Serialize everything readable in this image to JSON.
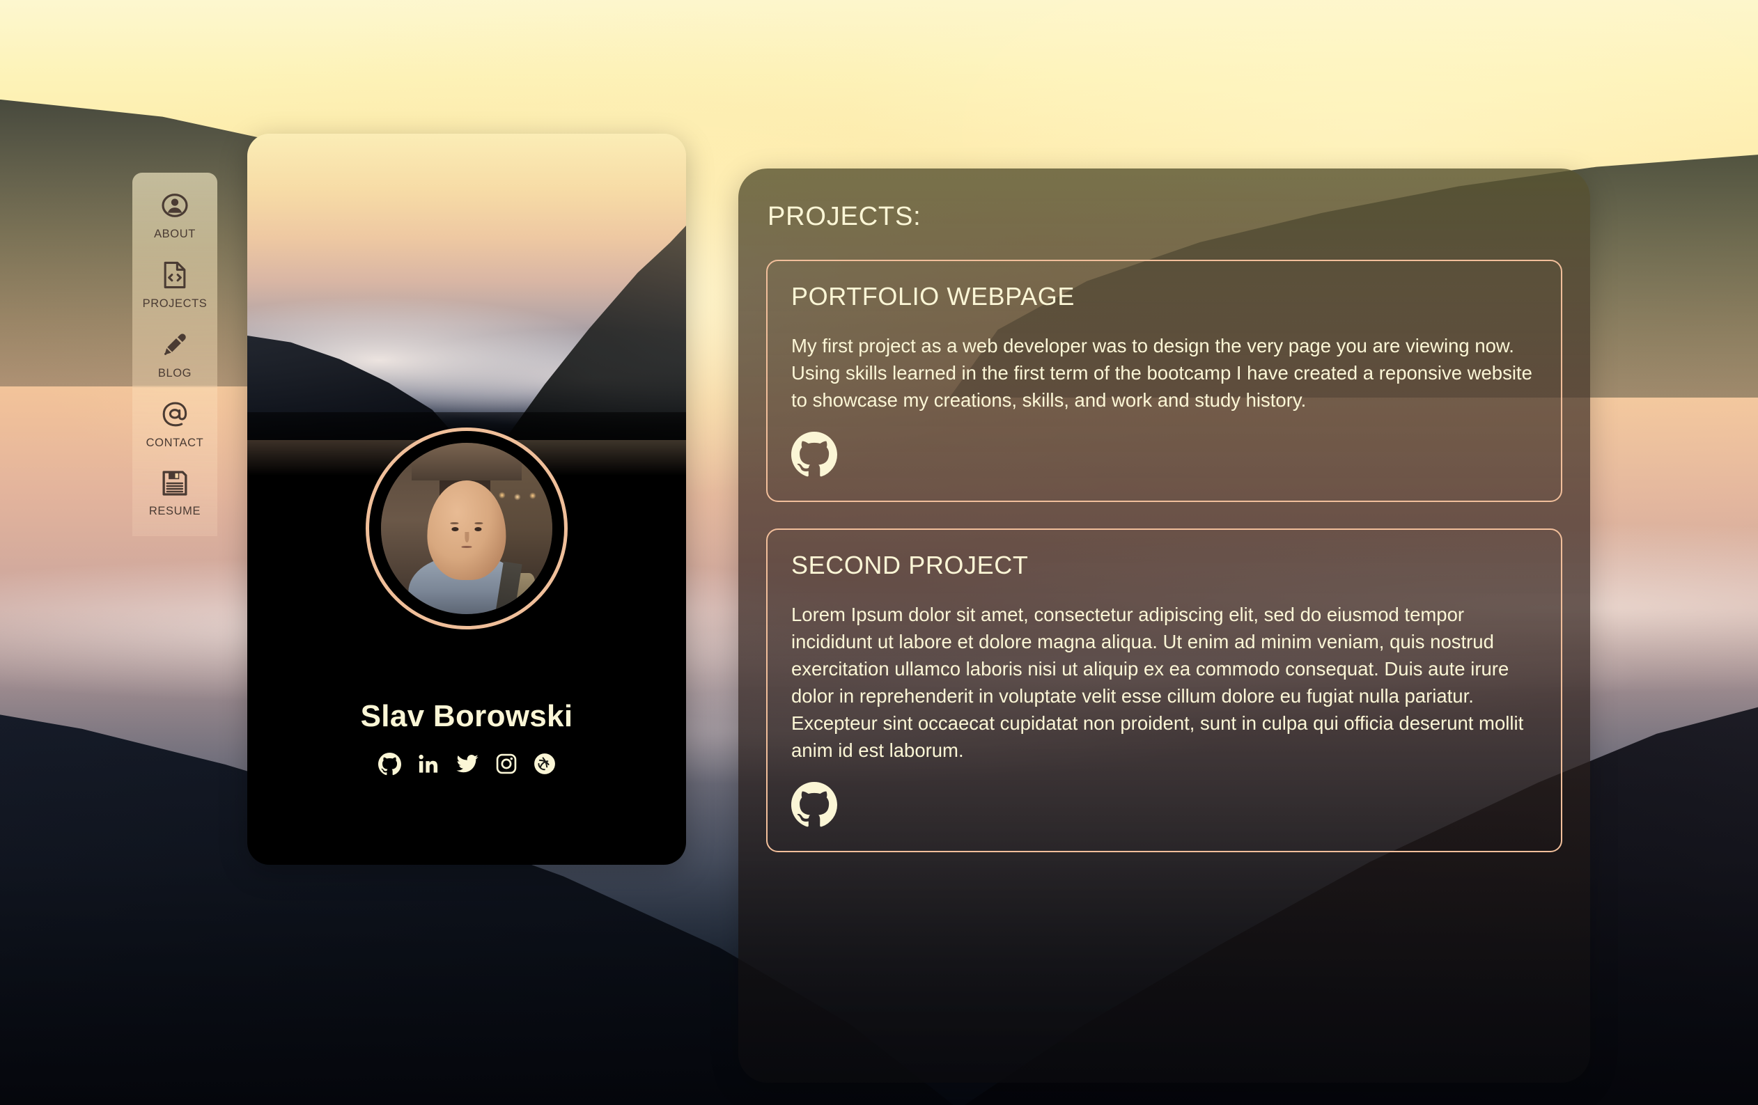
{
  "sidebar": {
    "items": [
      {
        "label": "ABOUT",
        "icon": "user-circle-icon",
        "active": true
      },
      {
        "label": "PROJECTS",
        "icon": "code-document-icon",
        "active": false
      },
      {
        "label": "BLOG",
        "icon": "marker-pen-icon",
        "active": false
      },
      {
        "label": "CONTACT",
        "icon": "at-sign-icon",
        "active": false
      },
      {
        "label": "RESUME",
        "icon": "floppy-disk-icon",
        "active": false
      }
    ]
  },
  "profile": {
    "name": "Slav Borowski",
    "avatar_alt": "profile-photo",
    "socials": [
      {
        "name": "github-icon",
        "label": "GitHub"
      },
      {
        "name": "linkedin-icon",
        "label": "LinkedIn"
      },
      {
        "name": "twitter-icon",
        "label": "Twitter"
      },
      {
        "name": "instagram-icon",
        "label": "Instagram"
      },
      {
        "name": "dribbble-icon",
        "label": "Dribbble"
      }
    ]
  },
  "projects": {
    "heading": "PROJECTS:",
    "items": [
      {
        "title": "PORTFOLIO WEBPAGE",
        "description": "My first project as a web developer was to design the very page you are viewing now. Using skills learned in the first term of the bootcamp I have created a reponsive website to showcase my creations, skills, and work and study history.",
        "link_icon": "github-icon"
      },
      {
        "title": "SECOND PROJECT",
        "description": "Lorem Ipsum dolor sit amet, consectetur adipiscing elit, sed do eiusmod tempor incididunt ut labore et dolore magna aliqua. Ut enim ad minim veniam, quis nostrud exercitation ullamco laboris nisi ut aliquip ex ea commodo consequat. Duis aute irure dolor in reprehenderit in voluptate velit esse cillum dolore eu fugiat nulla pariatur. Excepteur sint occaecat cupidatat non proident, sunt in culpa qui officia deserunt mollit anim id est laborum.",
        "link_icon": "github-icon"
      }
    ]
  },
  "colors": {
    "accent_border": "#f2bf9b",
    "text_cream": "#fbf6d6",
    "nav_text": "#4a3b33",
    "panel_overlay": "#3a3124"
  }
}
